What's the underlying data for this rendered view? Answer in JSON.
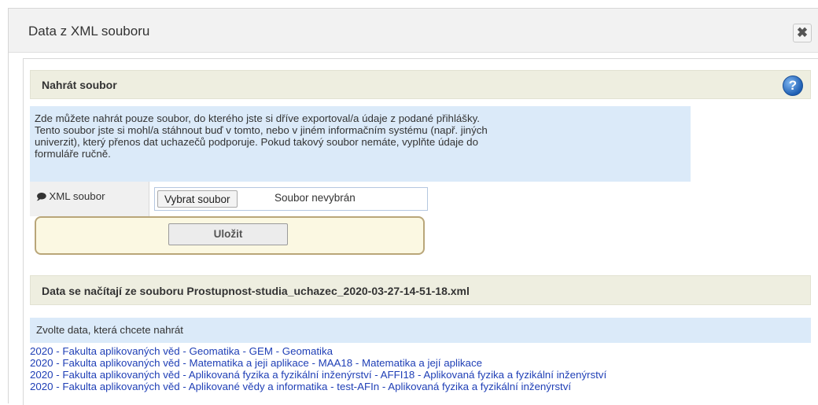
{
  "dialog": {
    "title": "Data z XML souboru",
    "close_glyph": "✖"
  },
  "upload": {
    "section_title": "Nahrát soubor",
    "help_glyph": "?",
    "info_lines": [
      "Zde můžete nahrát pouze soubor, do kterého jste si dříve exportoval/a údaje z podané přihlášky.",
      "Tento soubor jste si mohl/a stáhnout buď v tomto, nebo v jiném informačním systému (např. jiných",
      "univerzit), který přenos dat uchazečů podporuje. Pokud takový soubor nemáte, vyplňte údaje do",
      "formuláře ručně."
    ],
    "file_label": "XML soubor",
    "choose_button": "Vybrat soubor",
    "no_file_text": "Soubor nevybrán",
    "save_button": "Uložit"
  },
  "data_source": {
    "title": "Data se načítají ze souboru Prostupnost-studia_uchazec_2020-03-27-14-51-18.xml",
    "choose_label": "Zvolte data, která chcete nahrát",
    "options": [
      "2020 - Fakulta aplikovaných věd - Geomatika - GEM - Geomatika",
      "2020 - Fakulta aplikovaných věd - Matematika a jeji aplikace - MAA18 - Matematika a její aplikace",
      "2020 - Fakulta aplikovaných věd - Aplikovaná fyzika a fyzikální inženýrství - AFFI18 - Aplikovaná fyzika a fyzikální inženýrství",
      "2020 - Fakulta aplikovaných věd - Aplikované vědy a informatika - test-AFIn - Aplikovaná fyzika a fyzikální inženýrství"
    ]
  },
  "colors": {
    "section_bar": "#eeeee0",
    "info_background": "#dbeaf9",
    "link": "#1f3fb6",
    "save_panel_border": "#b9a679"
  },
  "icons": {
    "close": "close-icon",
    "help": "help-icon",
    "comment": "comment-icon"
  }
}
